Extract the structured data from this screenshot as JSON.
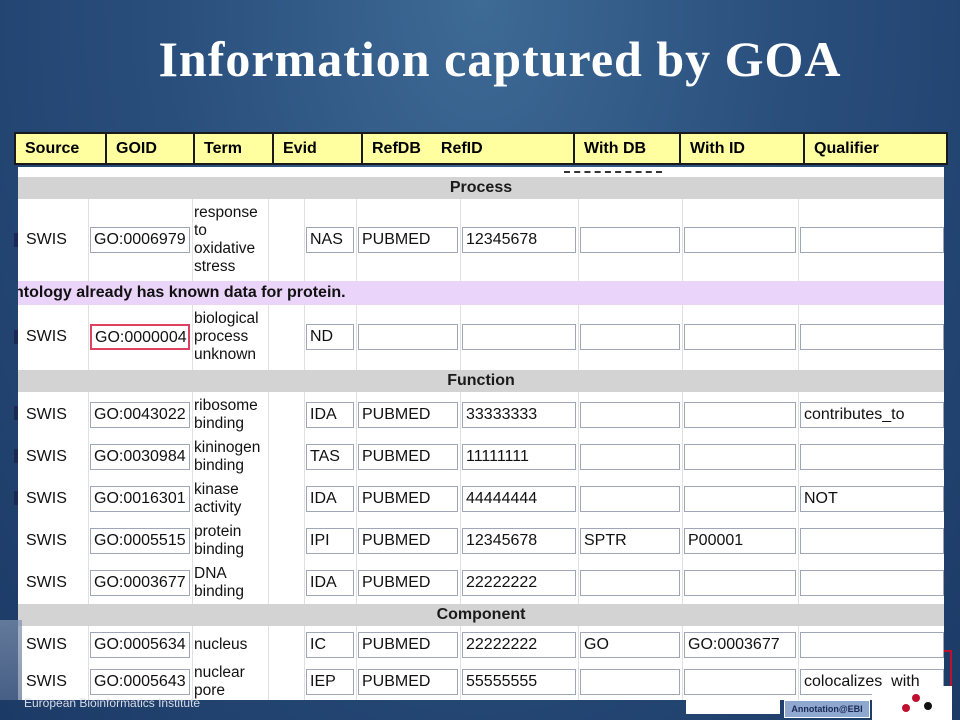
{
  "title": "Information captured by GOA",
  "columns": [
    "Source",
    "GOID",
    "Term",
    "Evid",
    "RefDB",
    "RefID",
    "With DB",
    "With ID",
    "Qualifier"
  ],
  "sections": {
    "process": "Process",
    "function": "Function",
    "component": "Component"
  },
  "warning": "ntology already has known data for protein.",
  "rows": [
    {
      "source": "SWIS",
      "goid": "GO:0006979",
      "term": "response to oxidative stress",
      "evid": "NAS",
      "refdb": "PUBMED",
      "refid": "12345678",
      "with_db": "",
      "with_id": "",
      "qualifier": ""
    },
    {
      "source": "SWIS",
      "goid": "GO:0000004",
      "term": "biological process unknown",
      "evid": "ND",
      "refdb": "",
      "refid": "",
      "with_db": "",
      "with_id": "",
      "qualifier": ""
    },
    {
      "source": "SWIS",
      "goid": "GO:0043022",
      "term": "ribosome binding",
      "evid": "IDA",
      "refdb": "PUBMED",
      "refid": "33333333",
      "with_db": "",
      "with_id": "",
      "qualifier": "contributes_to"
    },
    {
      "source": "SWIS",
      "goid": "GO:0030984",
      "term": "kininogen binding",
      "evid": "TAS",
      "refdb": "PUBMED",
      "refid": "11111111",
      "with_db": "",
      "with_id": "",
      "qualifier": ""
    },
    {
      "source": "SWIS",
      "goid": "GO:0016301",
      "term": "kinase activity",
      "evid": "IDA",
      "refdb": "PUBMED",
      "refid": "44444444",
      "with_db": "",
      "with_id": "",
      "qualifier": "NOT"
    },
    {
      "source": "SWIS",
      "goid": "GO:0005515",
      "term": "protein binding",
      "evid": "IPI",
      "refdb": "PUBMED",
      "refid": "12345678",
      "with_db": "SPTR",
      "with_id": "P00001",
      "qualifier": ""
    },
    {
      "source": "SWIS",
      "goid": "GO:0003677",
      "term": "DNA binding",
      "evid": "IDA",
      "refdb": "PUBMED",
      "refid": "22222222",
      "with_db": "",
      "with_id": "",
      "qualifier": ""
    },
    {
      "source": "SWIS",
      "goid": "GO:0005634",
      "term": "nucleus",
      "evid": "IC",
      "refdb": "PUBMED",
      "refid": "22222222",
      "with_db": "GO",
      "with_id": "GO:0003677",
      "qualifier": ""
    },
    {
      "source": "SWIS",
      "goid": "GO:0005643",
      "term": "nuclear pore",
      "evid": "IEP",
      "refdb": "PUBMED",
      "refid": "55555555",
      "with_db": "",
      "with_id": "",
      "qualifier": "colocalizes_with"
    }
  ],
  "footer": "European Bioinformatics Institute",
  "badge": "Annotation@EBI"
}
